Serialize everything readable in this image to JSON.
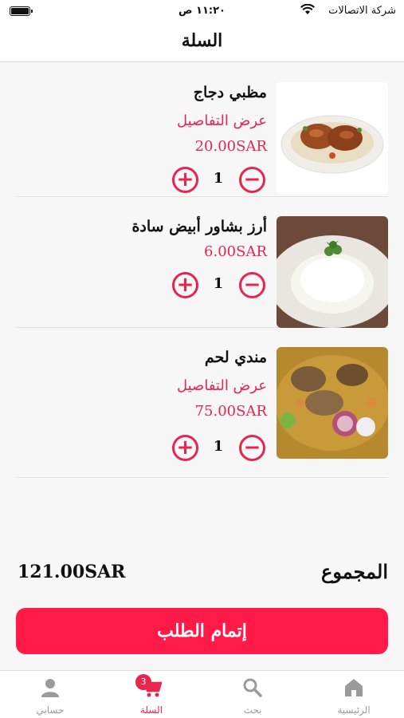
{
  "status_bar": {
    "carrier": "شركة الاتصالات",
    "time": "١١:٢٠ ص"
  },
  "header": {
    "title": "السلة"
  },
  "cart": {
    "items": [
      {
        "name": "مظبي دجاج",
        "details_label": "عرض التفاصيل",
        "price": "20.00SAR",
        "quantity": "1"
      },
      {
        "name": "أرز بشاور أبيض سادة",
        "price": "6.00SAR",
        "quantity": "1"
      },
      {
        "name": "مندي لحم",
        "details_label": "عرض التفاصيل",
        "price": "75.00SAR",
        "quantity": "1"
      }
    ]
  },
  "summary": {
    "total_label": "المجموع",
    "total_value": "121.00SAR"
  },
  "checkout": {
    "label": "إتمام الطلب"
  },
  "tab_bar": {
    "items": [
      {
        "label": "الرئيسية",
        "icon": "home-icon"
      },
      {
        "label": "بحث",
        "icon": "search-icon"
      },
      {
        "label": "السلة",
        "icon": "cart-icon",
        "badge": "3"
      },
      {
        "label": "حسابي",
        "icon": "account-icon"
      }
    ]
  },
  "colors": {
    "accent": "#e8254f",
    "button": "#ff1a4a"
  }
}
